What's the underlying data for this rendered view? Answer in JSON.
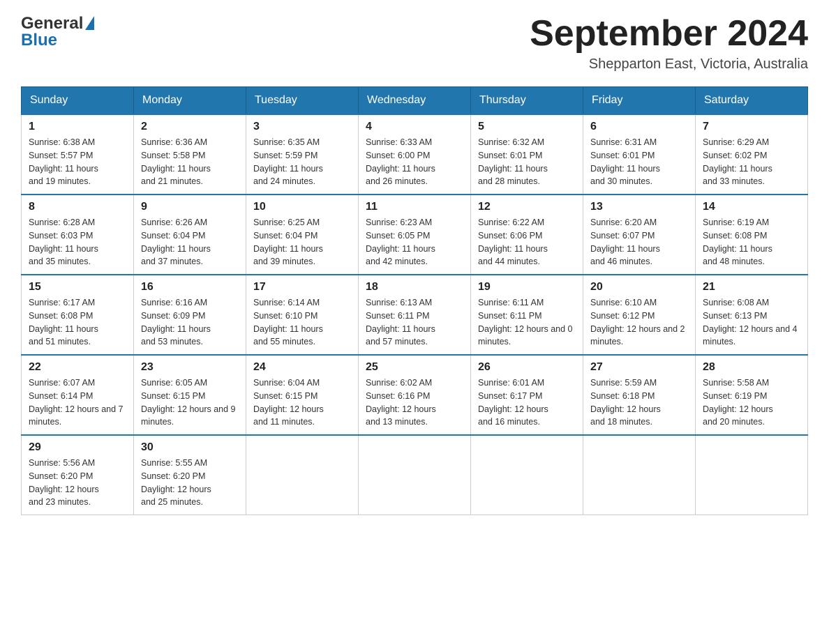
{
  "header": {
    "month_year": "September 2024",
    "location": "Shepparton East, Victoria, Australia",
    "logo_general": "General",
    "logo_blue": "Blue"
  },
  "weekdays": [
    "Sunday",
    "Monday",
    "Tuesday",
    "Wednesday",
    "Thursday",
    "Friday",
    "Saturday"
  ],
  "weeks": [
    [
      {
        "day": "1",
        "sunrise": "6:38 AM",
        "sunset": "5:57 PM",
        "daylight": "11 hours and 19 minutes."
      },
      {
        "day": "2",
        "sunrise": "6:36 AM",
        "sunset": "5:58 PM",
        "daylight": "11 hours and 21 minutes."
      },
      {
        "day": "3",
        "sunrise": "6:35 AM",
        "sunset": "5:59 PM",
        "daylight": "11 hours and 24 minutes."
      },
      {
        "day": "4",
        "sunrise": "6:33 AM",
        "sunset": "6:00 PM",
        "daylight": "11 hours and 26 minutes."
      },
      {
        "day": "5",
        "sunrise": "6:32 AM",
        "sunset": "6:01 PM",
        "daylight": "11 hours and 28 minutes."
      },
      {
        "day": "6",
        "sunrise": "6:31 AM",
        "sunset": "6:01 PM",
        "daylight": "11 hours and 30 minutes."
      },
      {
        "day": "7",
        "sunrise": "6:29 AM",
        "sunset": "6:02 PM",
        "daylight": "11 hours and 33 minutes."
      }
    ],
    [
      {
        "day": "8",
        "sunrise": "6:28 AM",
        "sunset": "6:03 PM",
        "daylight": "11 hours and 35 minutes."
      },
      {
        "day": "9",
        "sunrise": "6:26 AM",
        "sunset": "6:04 PM",
        "daylight": "11 hours and 37 minutes."
      },
      {
        "day": "10",
        "sunrise": "6:25 AM",
        "sunset": "6:04 PM",
        "daylight": "11 hours and 39 minutes."
      },
      {
        "day": "11",
        "sunrise": "6:23 AM",
        "sunset": "6:05 PM",
        "daylight": "11 hours and 42 minutes."
      },
      {
        "day": "12",
        "sunrise": "6:22 AM",
        "sunset": "6:06 PM",
        "daylight": "11 hours and 44 minutes."
      },
      {
        "day": "13",
        "sunrise": "6:20 AM",
        "sunset": "6:07 PM",
        "daylight": "11 hours and 46 minutes."
      },
      {
        "day": "14",
        "sunrise": "6:19 AM",
        "sunset": "6:08 PM",
        "daylight": "11 hours and 48 minutes."
      }
    ],
    [
      {
        "day": "15",
        "sunrise": "6:17 AM",
        "sunset": "6:08 PM",
        "daylight": "11 hours and 51 minutes."
      },
      {
        "day": "16",
        "sunrise": "6:16 AM",
        "sunset": "6:09 PM",
        "daylight": "11 hours and 53 minutes."
      },
      {
        "day": "17",
        "sunrise": "6:14 AM",
        "sunset": "6:10 PM",
        "daylight": "11 hours and 55 minutes."
      },
      {
        "day": "18",
        "sunrise": "6:13 AM",
        "sunset": "6:11 PM",
        "daylight": "11 hours and 57 minutes."
      },
      {
        "day": "19",
        "sunrise": "6:11 AM",
        "sunset": "6:11 PM",
        "daylight": "12 hours and 0 minutes."
      },
      {
        "day": "20",
        "sunrise": "6:10 AM",
        "sunset": "6:12 PM",
        "daylight": "12 hours and 2 minutes."
      },
      {
        "day": "21",
        "sunrise": "6:08 AM",
        "sunset": "6:13 PM",
        "daylight": "12 hours and 4 minutes."
      }
    ],
    [
      {
        "day": "22",
        "sunrise": "6:07 AM",
        "sunset": "6:14 PM",
        "daylight": "12 hours and 7 minutes."
      },
      {
        "day": "23",
        "sunrise": "6:05 AM",
        "sunset": "6:15 PM",
        "daylight": "12 hours and 9 minutes."
      },
      {
        "day": "24",
        "sunrise": "6:04 AM",
        "sunset": "6:15 PM",
        "daylight": "12 hours and 11 minutes."
      },
      {
        "day": "25",
        "sunrise": "6:02 AM",
        "sunset": "6:16 PM",
        "daylight": "12 hours and 13 minutes."
      },
      {
        "day": "26",
        "sunrise": "6:01 AM",
        "sunset": "6:17 PM",
        "daylight": "12 hours and 16 minutes."
      },
      {
        "day": "27",
        "sunrise": "5:59 AM",
        "sunset": "6:18 PM",
        "daylight": "12 hours and 18 minutes."
      },
      {
        "day": "28",
        "sunrise": "5:58 AM",
        "sunset": "6:19 PM",
        "daylight": "12 hours and 20 minutes."
      }
    ],
    [
      {
        "day": "29",
        "sunrise": "5:56 AM",
        "sunset": "6:20 PM",
        "daylight": "12 hours and 23 minutes."
      },
      {
        "day": "30",
        "sunrise": "5:55 AM",
        "sunset": "6:20 PM",
        "daylight": "12 hours and 25 minutes."
      },
      null,
      null,
      null,
      null,
      null
    ]
  ],
  "labels": {
    "sunrise": "Sunrise:",
    "sunset": "Sunset:",
    "daylight": "Daylight:"
  }
}
